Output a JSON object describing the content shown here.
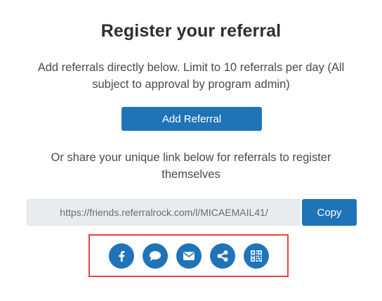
{
  "page": {
    "title": "Register your referral",
    "description": "Add referrals directly below. Limit to 10 referrals per day (All subject to approval by program admin)",
    "add_button_label": "Add Referral",
    "share_text": "Or share your unique link below for referrals to register themselves"
  },
  "link": {
    "value": "https://friends.referralrock.com/l/MICAEMAIL41/",
    "copy_label": "Copy"
  },
  "share_buttons": [
    {
      "icon": "facebook-icon"
    },
    {
      "icon": "chat-bubble-icon"
    },
    {
      "icon": "email-icon"
    },
    {
      "icon": "share-icon"
    },
    {
      "icon": "qr-code-icon"
    }
  ],
  "colors": {
    "accent": "#1f74b8",
    "highlight": "#e8433f",
    "input_bg": "#e9ecef"
  }
}
